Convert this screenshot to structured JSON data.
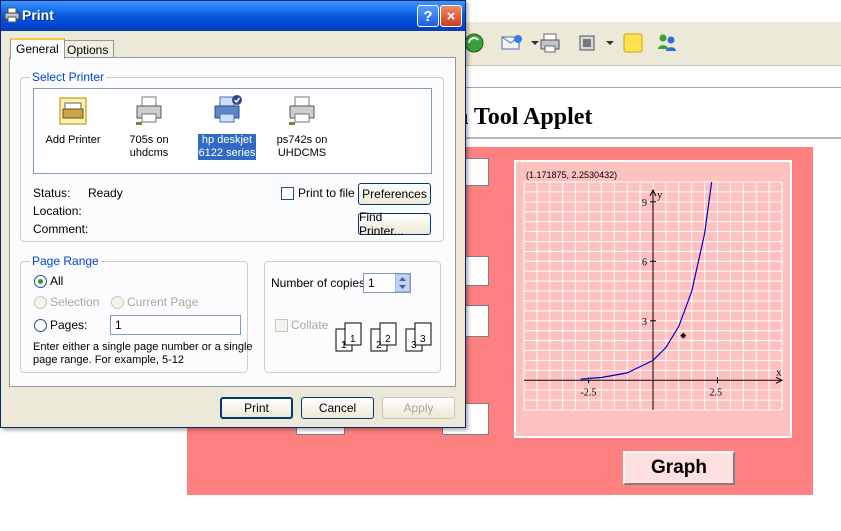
{
  "dialog": {
    "title": "Print",
    "help_button": "?",
    "close_button": "×",
    "tabs": [
      "General",
      "Options"
    ],
    "select_printer_label": "Select Printer",
    "printers": [
      {
        "name_line1": "Add Printer",
        "name_line2": "",
        "icon": "add-printer-icon"
      },
      {
        "name_line1": "705s on",
        "name_line2": "uhdcms",
        "icon": "printer-icon"
      },
      {
        "name_line1": "hp deskjet",
        "name_line2": "6122 series",
        "icon": "default-printer-icon",
        "selected": true
      },
      {
        "name_line1": "ps742s on",
        "name_line2": "UHDCMS",
        "icon": "printer-icon"
      }
    ],
    "status_label": "Status:",
    "status_value": "Ready",
    "location_label": "Location:",
    "comment_label": "Comment:",
    "print_to_file": "Print to file",
    "preferences_button": "Preferences",
    "find_printer_button": "Find Printer...",
    "page_range_label": "Page Range",
    "all_label": "All",
    "selection_label": "Selection",
    "current_page_label": "Current Page",
    "pages_label": "Pages:",
    "pages_value": "1",
    "page_hint_line1": "Enter either a single page number or a single",
    "page_hint_line2": "page range.  For example, 5-12",
    "copies_label": "Number of copies:",
    "copies_value": "1",
    "collate_label": "Collate",
    "collate_pages": [
      "1",
      "1",
      "2",
      "2",
      "3",
      "3"
    ],
    "print_button": "Print",
    "cancel_button": "Cancel",
    "apply_button": "Apply"
  },
  "applet": {
    "title": "n Tool Applet",
    "coordinate_readout": "(1.171875, 2.2530432)",
    "graph_button": "Graph",
    "accent_color": "#ff8080",
    "chart_data": {
      "type": "line",
      "x_axis_label": "x",
      "y_axis_label": "y",
      "x_ticks": [
        "-2.5",
        "2.5"
      ],
      "y_ticks": [
        "3",
        "6",
        "9"
      ],
      "xlim": [
        -5,
        5
      ],
      "ylim": [
        -1.5,
        10
      ],
      "series": [
        {
          "x": [
            -2.8,
            -2,
            -1,
            0,
            0.5,
            1,
            1.5,
            2,
            2.5,
            2.8
          ],
          "y": [
            0.06,
            0.14,
            0.37,
            1.0,
            1.65,
            2.72,
            4.48,
            7.39,
            12.18,
            16.44
          ],
          "color": "#0000cc"
        }
      ],
      "marker": {
        "x": 1.171875,
        "y": 2.2530432
      },
      "grid": true
    }
  }
}
